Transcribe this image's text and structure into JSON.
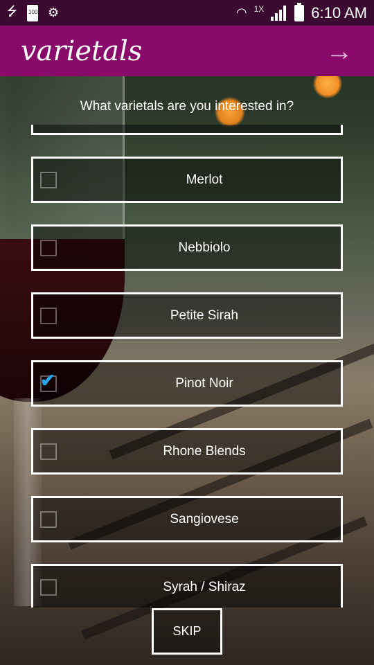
{
  "status_bar": {
    "battery_badge": "100",
    "network_label": "1X",
    "time": "6:10 AM"
  },
  "header": {
    "logo_text": "varietals",
    "next_icon": "arrow-right-icon"
  },
  "question": "What varietals are you interested in?",
  "varietals": [
    {
      "label": "Merlot",
      "checked": false
    },
    {
      "label": "Nebbiolo",
      "checked": false
    },
    {
      "label": "Petite Sirah",
      "checked": false
    },
    {
      "label": "Pinot Noir",
      "checked": true
    },
    {
      "label": "Rhone Blends",
      "checked": false
    },
    {
      "label": "Sangiovese",
      "checked": false
    },
    {
      "label": "Syrah / Shiraz",
      "checked": false
    }
  ],
  "skip_label": "SKIP",
  "colors": {
    "header": "#8a0a6b",
    "status_bar": "#3b0a30",
    "check": "#2aa6e8"
  }
}
